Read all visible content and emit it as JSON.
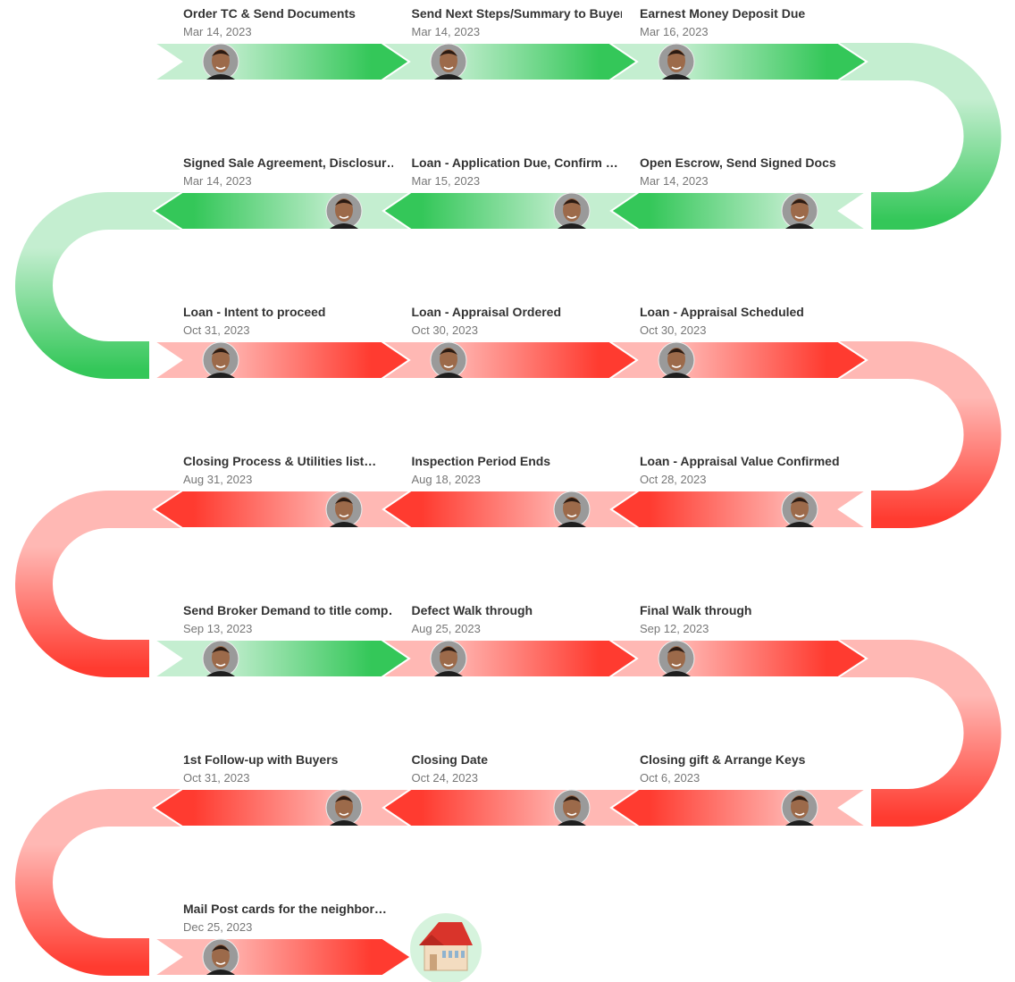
{
  "colors": {
    "done": {
      "solid": "#34c759",
      "pale": "#c4eed0"
    },
    "overdue": {
      "solid": "#ff3b30",
      "pale": "#ffb8b4"
    },
    "house_bg": "#d6f3dd"
  },
  "end_icon": "house-icon",
  "avatar_icon": "assignee-avatar",
  "tasks": [
    {
      "title": "Order TC & Send Documents",
      "date": "Mar 14, 2023",
      "status": "done"
    },
    {
      "title": "Send Next Steps/Summary to Buyer…",
      "date": "Mar 14, 2023",
      "status": "done"
    },
    {
      "title": "Earnest Money Deposit Due",
      "date": "Mar 16, 2023",
      "status": "done"
    },
    {
      "title": "Open Escrow, Send Signed Docs",
      "date": "Mar 14, 2023",
      "status": "done"
    },
    {
      "title": "Loan - Application Due, Confirm …",
      "date": "Mar 15, 2023",
      "status": "done"
    },
    {
      "title": "Signed Sale Agreement, Disclosur…",
      "date": "Mar 14, 2023",
      "status": "done"
    },
    {
      "title": "Loan - Intent to proceed",
      "date": "Oct 31, 2023",
      "status": "overdue"
    },
    {
      "title": "Loan - Appraisal Ordered",
      "date": "Oct 30, 2023",
      "status": "overdue"
    },
    {
      "title": "Loan - Appraisal Scheduled",
      "date": "Oct 30, 2023",
      "status": "overdue"
    },
    {
      "title": "Loan - Appraisal Value Confirmed",
      "date": "Oct 28, 2023",
      "status": "overdue"
    },
    {
      "title": "Inspection Period Ends",
      "date": "Aug 18, 2023",
      "status": "overdue"
    },
    {
      "title": "Closing Process & Utilities list…",
      "date": "Aug 31, 2023",
      "status": "overdue"
    },
    {
      "title": "Send Broker Demand to title comp…",
      "date": "Sep 13, 2023",
      "status": "done"
    },
    {
      "title": "Defect Walk through",
      "date": "Aug 25, 2023",
      "status": "overdue"
    },
    {
      "title": "Final Walk through",
      "date": "Sep 12, 2023",
      "status": "overdue"
    },
    {
      "title": "Closing gift & Arrange Keys",
      "date": "Oct 6, 2023",
      "status": "overdue"
    },
    {
      "title": "Closing Date",
      "date": "Oct 24, 2023",
      "status": "overdue"
    },
    {
      "title": "1st Follow-up with Buyers",
      "date": "Oct 31, 2023",
      "status": "overdue"
    },
    {
      "title": "Mail Post cards for the neighbor…",
      "date": "Dec 25, 2023",
      "status": "overdue"
    }
  ]
}
